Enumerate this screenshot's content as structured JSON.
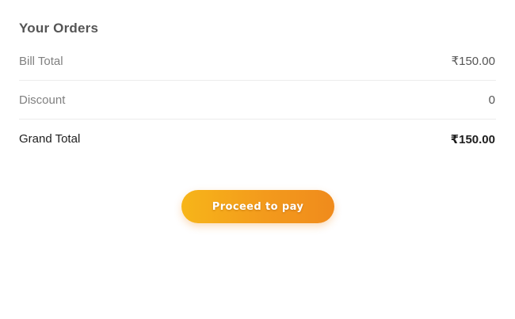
{
  "header": {
    "title": "Your Orders"
  },
  "summary": {
    "rows": [
      {
        "label": "Bill Total",
        "value": "₹150.00"
      },
      {
        "label": "Discount",
        "value": "0"
      },
      {
        "label": "Grand Total",
        "value": "₹150.00"
      }
    ]
  },
  "actions": {
    "proceed_label": "Proceed to pay"
  },
  "colors": {
    "accent_start": "#f7b519",
    "accent_end": "#f08b1c"
  }
}
